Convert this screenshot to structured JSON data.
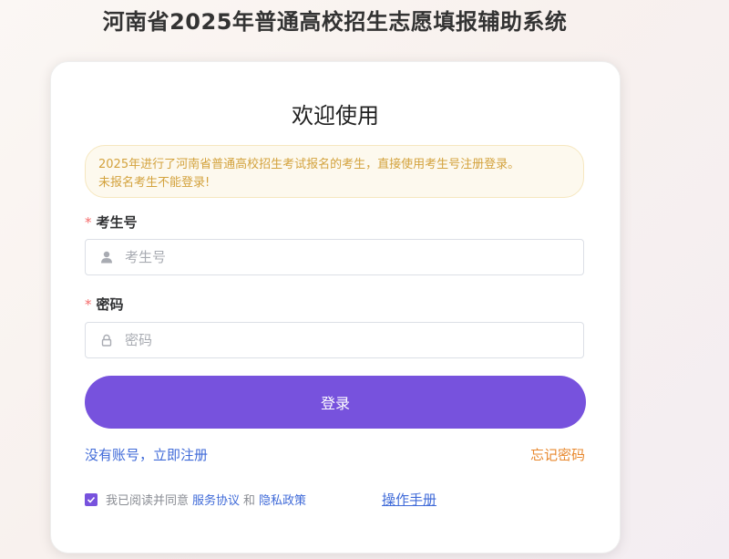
{
  "header": {
    "title": "河南省2025年普通高校招生志愿填报辅助系统"
  },
  "login": {
    "welcome": "欢迎使用",
    "notice_line1": "2025年进行了河南省普通高校招生考试报名的考生，直接使用考生号注册登录。",
    "notice_line2": "未报名考生不能登录!",
    "exam_id": {
      "required_mark": "*",
      "label": "考生号",
      "placeholder": "考生号",
      "value": "",
      "icon": "user-icon"
    },
    "password": {
      "required_mark": "*",
      "label": "密码",
      "placeholder": "密码",
      "value": "",
      "icon": "lock-icon"
    },
    "submit_label": "登录",
    "register_link": "没有账号，立即注册",
    "forgot_link": "忘记密码",
    "agreement": {
      "checked": true,
      "prefix": "我已阅读并同意",
      "service_link": "服务协议",
      "conjunction": "和",
      "privacy_link": "隐私政策"
    },
    "manual_link": "操作手册"
  },
  "colors": {
    "accent": "#7752dd",
    "link": "#3f6ad8",
    "warning": "#e8882e",
    "notice_text": "#d3a23d",
    "required": "#f56c6c"
  }
}
